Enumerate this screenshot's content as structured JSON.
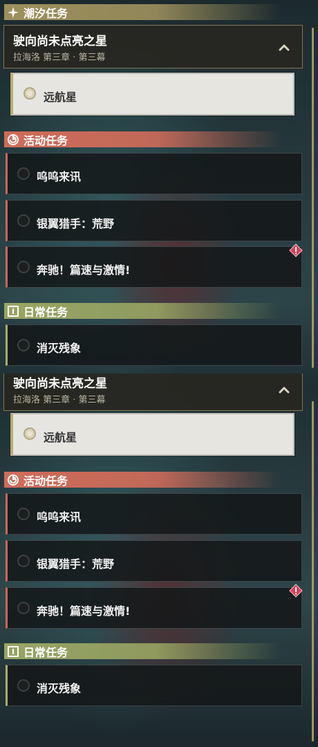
{
  "colors": {
    "tide": "#a5965f",
    "event": "#da6e5a",
    "daily": "#9eaa64",
    "alert": "#d8405a"
  },
  "views": [
    {
      "tide_header": {
        "title": "潮汐任务",
        "icon": "sparkle-icon"
      },
      "main_quest": {
        "title": "驶向尚未点亮之星",
        "subtitle": "拉海洛 第三章 · 第三幕",
        "expand_icon": "chevron-up-icon"
      },
      "objective": {
        "label": "远航星"
      },
      "event_header": {
        "title": "活动任务",
        "icon": "event-quest-icon"
      },
      "event_quests": [
        {
          "label": "呜呜来讯"
        },
        {
          "label": "银翼猎手：荒野"
        },
        {
          "label": "奔驰！篇速与激情!",
          "alert": true
        }
      ],
      "daily_header": {
        "title": "日常任务",
        "icon": "daily-quest-icon"
      },
      "daily_quests": [
        {
          "label": "消灭残象"
        }
      ]
    },
    {
      "main_quest": {
        "title": "驶向尚未点亮之星",
        "subtitle": "拉海洛 第三章 · 第三幕",
        "expand_icon": "chevron-up-icon"
      },
      "objective": {
        "label": "远航星"
      },
      "event_header": {
        "title": "活动任务",
        "icon": "event-quest-icon"
      },
      "event_quests": [
        {
          "label": "呜呜来讯"
        },
        {
          "label": "银翼猎手：荒野"
        },
        {
          "label": "奔驰！篇速与激情!",
          "alert": true
        }
      ],
      "daily_header": {
        "title": "日常任务",
        "icon": "daily-quest-icon"
      },
      "daily_quests": [
        {
          "label": "消灭残象"
        }
      ]
    }
  ]
}
